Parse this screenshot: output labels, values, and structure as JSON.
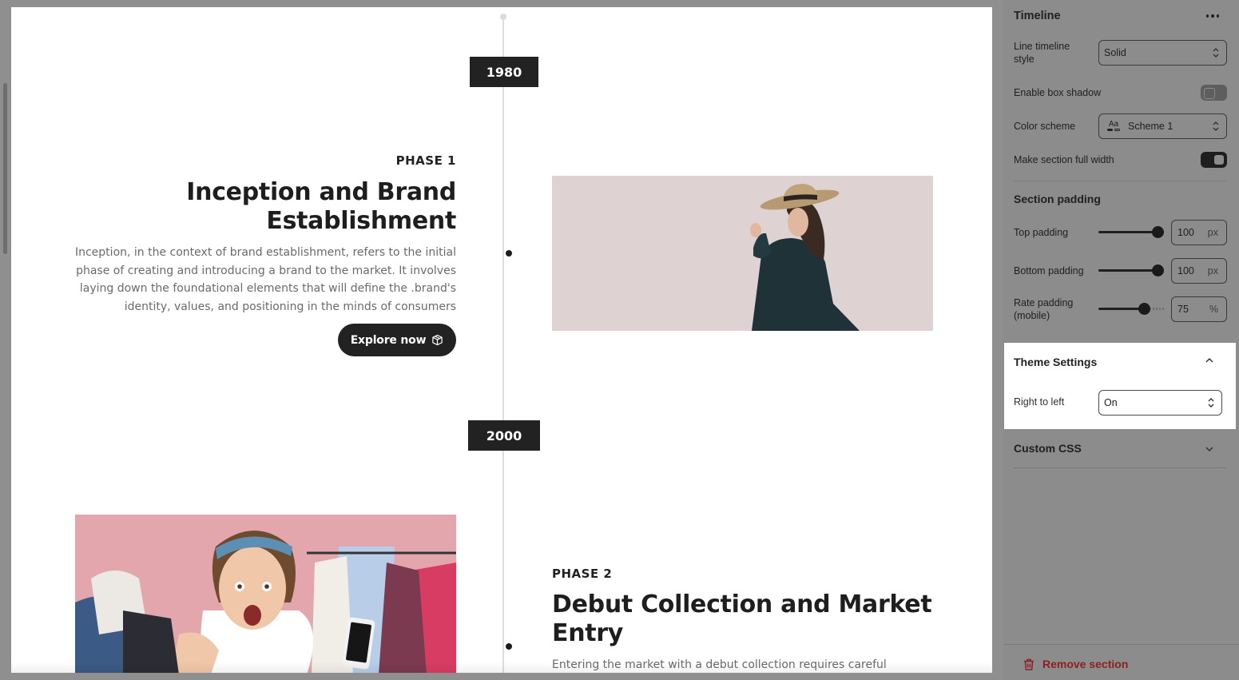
{
  "timeline": {
    "items": [
      {
        "year": "1980",
        "phase": "PHASE 1",
        "title": "Inception and Brand Establishment",
        "description": "Inception, in the context of brand establishment, refers to the initial phase of creating and introducing a brand to the market. It involves laying down the foundational elements that will define the .brand's identity, values, and positioning in the minds of consumers",
        "button_label": "Explore now",
        "button_icon": "box-icon"
      },
      {
        "year": "2000",
        "phase": "PHASE 2",
        "title": "Debut Collection and Market Entry",
        "description": "Entering the market with a debut collection requires careful"
      }
    ]
  },
  "panel": {
    "title": "Timeline",
    "more_icon": "more-horizontal-icon",
    "line_style": {
      "label": "Line timeline style",
      "value": "Solid"
    },
    "box_shadow": {
      "label": "Enable box shadow",
      "enabled": false
    },
    "color_scheme": {
      "label": "Color scheme",
      "value": "Scheme 1",
      "icon": "color-scheme-icon",
      "icon_text": "Aa"
    },
    "full_width": {
      "label": "Make section full width",
      "enabled": true
    },
    "section_padding": {
      "heading": "Section padding",
      "top": {
        "label": "Top padding",
        "value": "100",
        "unit": "px",
        "level": 1.0
      },
      "bottom": {
        "label": "Bottom padding",
        "value": "100",
        "unit": "px",
        "level": 1.0
      },
      "mobile": {
        "label": "Rate padding (mobile)",
        "value": "75",
        "unit": "%",
        "level": 0.75
      }
    },
    "theme_settings": {
      "title": "Theme Settings",
      "rtl": {
        "label": "Right to left",
        "value": "On"
      }
    },
    "custom_css": {
      "title": "Custom CSS"
    },
    "remove_section": "Remove section"
  },
  "colors": {
    "accent": "#222222",
    "danger": "#8e1f1f",
    "image1_bg": "#dfd2d3",
    "image2_bg": "#e4a6ad"
  }
}
